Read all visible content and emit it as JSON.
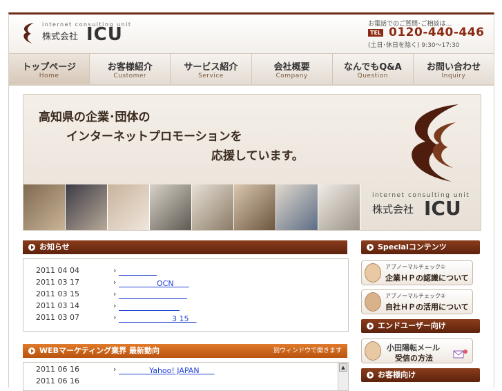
{
  "header": {
    "tagline": "internet consulting unit",
    "company": "株式会社",
    "brand": "ICU",
    "contact_lead": "お電話でのご質問･ご相談は…",
    "tel_badge": "TEL",
    "tel": "0120-440-446",
    "hours": "(土日･休日を除く) 9:30〜17:30"
  },
  "nav": [
    {
      "jp": "トップページ",
      "en": "Home"
    },
    {
      "jp": "お客様紹介",
      "en": "Customer"
    },
    {
      "jp": "サービス紹介",
      "en": "Service"
    },
    {
      "jp": "会社概要",
      "en": "Company"
    },
    {
      "jp": "なんでもQ&A",
      "en": "Question"
    },
    {
      "jp": "お問い合わせ",
      "en": "Inquiry"
    }
  ],
  "hero": {
    "line1": "高知県の企業･団体の",
    "line2": "インターネットプロモーションを",
    "line3": "応援しています。",
    "tagline": "internet consulting unit",
    "company": "株式会社",
    "brand": "ICU"
  },
  "news": {
    "title": "お知らせ",
    "items": [
      {
        "date": "2011 04 04",
        "arrow": "›",
        "link": "　　　　　"
      },
      {
        "date": "2011 03 17",
        "arrow": "›",
        "link": "　　　　　OCN　　"
      },
      {
        "date": "2011 03 15",
        "arrow": "›",
        "link": "　　　　　　　　　"
      },
      {
        "date": "2011 03 14",
        "arrow": "›",
        "link": "　　　　　　　　"
      },
      {
        "date": "2011 03 07",
        "arrow": "›",
        "link": "　　　　　　　3 15　"
      }
    ]
  },
  "web": {
    "title": "WEBマーケティング業界 最新動向",
    "note": "別ウィンドウで開きます",
    "items": [
      {
        "date": "2011 06 16",
        "arrow": "›",
        "link": "　　　　Yahoo! JAPAN　　"
      },
      {
        "date": "2011 06 16",
        "arrow": "",
        "link": ""
      }
    ]
  },
  "side": {
    "special_title": "Specialコンテンツ",
    "check1_small": "アブノーマルチェック①",
    "check1_big": "企業ＨＰの認識について",
    "check2_small": "アブノーマルチェック②",
    "check2_big": "自社ＨＰの活用について",
    "enduser_title": "エンドユーザー向け",
    "mail_line1": "小田陽転メール",
    "mail_line2": "受信の方法",
    "customer_title": "お客様向け"
  }
}
